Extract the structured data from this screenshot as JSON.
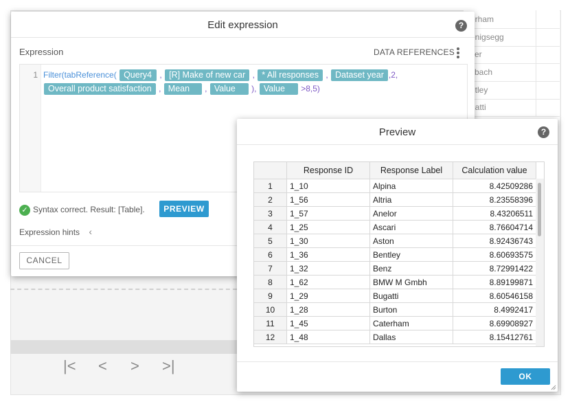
{
  "background": {
    "grid_rows": [
      "erham",
      "enigsegg",
      "ker",
      "ybach",
      "ntley",
      "gatti"
    ],
    "pager": {
      "first": "|<",
      "prev": "<",
      "next": ">",
      "last": ">|"
    }
  },
  "edit_dialog": {
    "title": "Edit expression",
    "help": "?",
    "expression_label": "Expression",
    "data_references": "DATA REFERENCES",
    "line_number": "1",
    "code": {
      "fn1": "Filter(",
      "fn2": "tabReference(",
      "chips": [
        "Query4",
        "[R] Make of new car",
        "* All responses",
        "Dataset year",
        "Overall product satisfaction",
        "Mean",
        "Value",
        "Value"
      ],
      "comma": ",",
      "num_2": ",2,",
      "close": "),",
      "tail": ">8,5)"
    },
    "status_text": "Syntax correct. Result: [Table].",
    "preview_button": "PREVIEW",
    "expression_hints": "Expression hints",
    "cancel_button": "CANCEL"
  },
  "preview_dialog": {
    "title": "Preview",
    "help": "?",
    "columns": [
      "Response ID",
      "Response Label",
      "Calculation value"
    ],
    "rows": [
      {
        "n": "1",
        "id": "1_10",
        "label": "Alpina",
        "value": "8.42509286"
      },
      {
        "n": "2",
        "id": "1_56",
        "label": "Altria",
        "value": "8.23558396"
      },
      {
        "n": "3",
        "id": "1_57",
        "label": "Anelor",
        "value": "8.43206511"
      },
      {
        "n": "4",
        "id": "1_25",
        "label": "Ascari",
        "value": "8.76604714"
      },
      {
        "n": "5",
        "id": "1_30",
        "label": "Aston",
        "value": "8.92436743"
      },
      {
        "n": "6",
        "id": "1_36",
        "label": "Bentley",
        "value": "8.60693575"
      },
      {
        "n": "7",
        "id": "1_32",
        "label": "Benz",
        "value": "8.72991422"
      },
      {
        "n": "8",
        "id": "1_62",
        "label": "BMW M Gmbh",
        "value": "8.89199871"
      },
      {
        "n": "9",
        "id": "1_29",
        "label": "Bugatti",
        "value": "8.60546158"
      },
      {
        "n": "10",
        "id": "1_28",
        "label": "Burton",
        "value": "8.4992417"
      },
      {
        "n": "11",
        "id": "1_45",
        "label": "Caterham",
        "value": "8.69908927"
      },
      {
        "n": "12",
        "id": "1_48",
        "label": "Dallas",
        "value": "8.15412761"
      }
    ],
    "ok_button": "OK"
  }
}
